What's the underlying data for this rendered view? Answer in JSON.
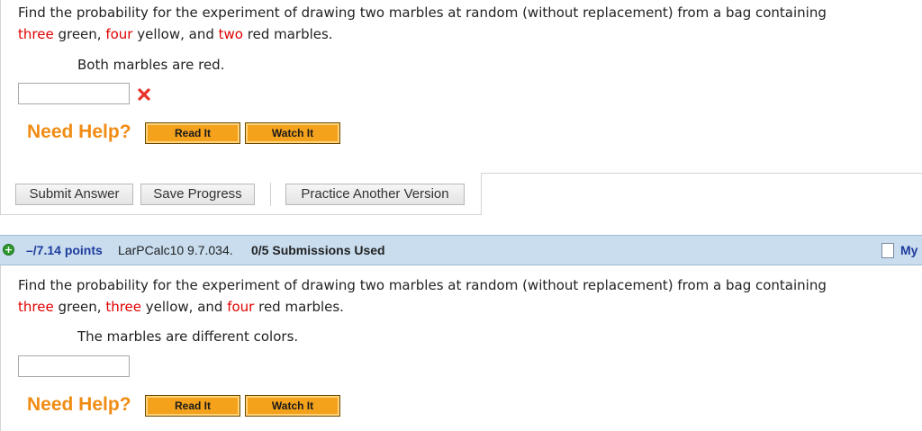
{
  "q1": {
    "text_line1": "Find the probability for the experiment of drawing two marbles at random (without replacement) from a bag containing",
    "line2": {
      "n1": "three",
      "t1": " green, ",
      "n2": "four",
      "t2": " yellow, and ",
      "n3": "two",
      "t3": " red marbles."
    },
    "sub_question": "Both marbles are red.",
    "answer_value": "",
    "need_help": "Need Help?",
    "read_it": "Read It",
    "watch_it": "Watch It",
    "submit": "Submit Answer",
    "save": "Save Progress",
    "practice": "Practice Another Version"
  },
  "q2": {
    "header": {
      "plus": "+",
      "points": "–/7.14 points",
      "problem_id": "LarPCalc10 9.7.034.",
      "submissions": "0/5 Submissions Used",
      "my_notes": "My"
    },
    "text_line1": "Find the probability for the experiment of drawing two marbles at random (without replacement) from a bag containing",
    "line2": {
      "n1": "three",
      "t1": " green, ",
      "n2": "three",
      "t2": " yellow, and ",
      "n3": "four",
      "t3": " red marbles."
    },
    "sub_question": "The marbles are different colors.",
    "answer_value": "",
    "need_help": "Need Help?",
    "read_it": "Read It",
    "watch_it": "Watch It"
  },
  "colors": {
    "emphasis": "#e00000",
    "help": "#f08c14",
    "header_bg": "#c9ddef",
    "link": "#1f3c9c"
  }
}
